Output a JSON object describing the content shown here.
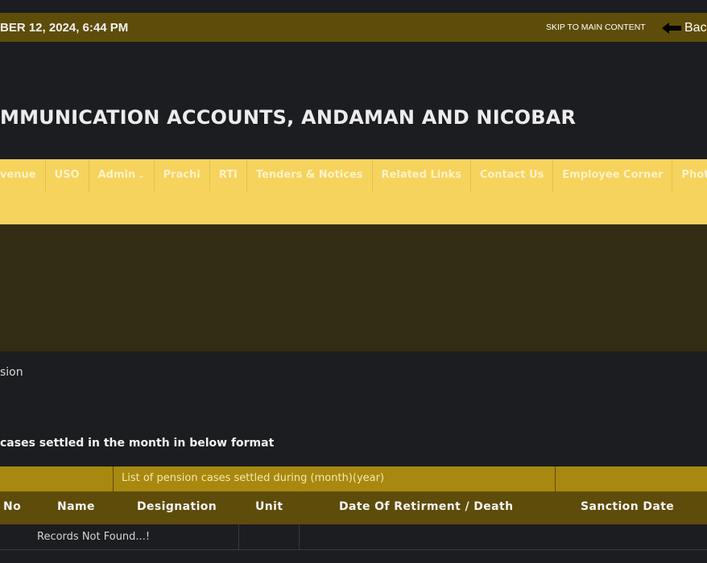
{
  "topbar": {
    "datetime": "BER 12, 2024, 6:44 PM",
    "skip_link": "SKIP TO MAIN CONTENT",
    "back_label": "Bac"
  },
  "header": {
    "title": "MMUNICATION ACCOUNTS, ANDAMAN AND NICOBAR"
  },
  "nav": {
    "items": [
      {
        "label": "venue"
      },
      {
        "label": "USO"
      },
      {
        "label": "Admin"
      },
      {
        "label": "Prachi"
      },
      {
        "label": "RTI"
      },
      {
        "label": "Tenders & Notices"
      },
      {
        "label": "Related Links"
      },
      {
        "label": "Contact Us"
      },
      {
        "label": "Employee Corner"
      },
      {
        "label": "Photo Ga"
      }
    ]
  },
  "breadcrumb": {
    "current": "sion"
  },
  "content": {
    "instruction": "cases settled in the month in below format"
  },
  "table": {
    "caption": "List of pension cases settled during (month)(year)",
    "headers": [
      "No",
      "Name",
      "Designation",
      "Unit",
      "Date Of Retirment / Death",
      "Sanction Date"
    ],
    "empty_message": "Records Not Found...!"
  },
  "colors": {
    "background": "#1c1d20",
    "topbar": "#5e4c0a",
    "nav": "#f6d35c",
    "banner": "#322d13",
    "table_caption": "#a8880e"
  }
}
